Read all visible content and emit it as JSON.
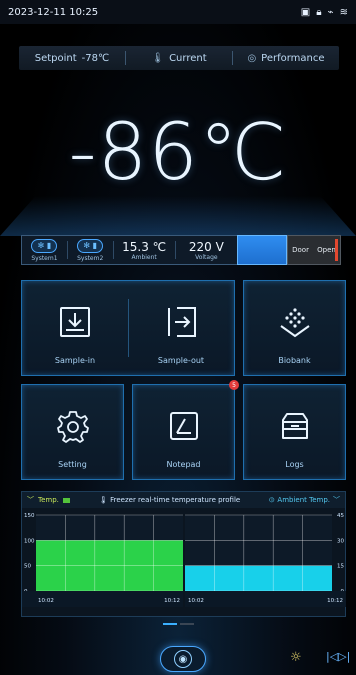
{
  "status": {
    "datetime": "2023-12-11 10:25",
    "icons": [
      "screen-icon",
      "lock-icon",
      "usb-icon",
      "wifi-icon"
    ]
  },
  "topbar": {
    "setpoint_label": "Setpoint",
    "setpoint_value": "-78℃",
    "current_label": "Current",
    "performance_label": "Performance"
  },
  "temperature": {
    "value": "-86",
    "unit": "℃"
  },
  "info": {
    "system1": "System1",
    "system2": "System2",
    "ambient_value": "15.3 ℃",
    "ambient_label": "Ambient",
    "voltage_value": "220 V",
    "voltage_label": "Voltage",
    "door_label": "Door",
    "door_state": "Open"
  },
  "tiles": {
    "sample_in": "Sample-in",
    "sample_out": "Sample-out",
    "biobank": "Biobank",
    "setting": "Setting",
    "notepad": "Notepad",
    "notepad_badge": "5",
    "logs": "Logs"
  },
  "chart_panel": {
    "left_tab": "Temp.",
    "title": "Freezer real-time temperature profile",
    "right_tab": "Ambient Temp."
  },
  "chart_data": [
    {
      "type": "bar",
      "series": [
        {
          "name": "Temp.",
          "values": [
            100
          ]
        }
      ],
      "ylim": [
        0,
        150
      ],
      "yticks": [
        "150",
        "100",
        "50",
        "0"
      ],
      "x_start": "10:02",
      "x_end": "10:12",
      "color": "#2bd24a"
    },
    {
      "type": "bar",
      "series": [
        {
          "name": "Ambient Temp.",
          "values": [
            15
          ]
        }
      ],
      "ylim": [
        0,
        45
      ],
      "yticks": [
        "45",
        "30",
        "15",
        "0"
      ],
      "x_start": "10:02",
      "x_end": "10:12",
      "color": "#18d0ea"
    }
  ],
  "colors": {
    "accent": "#3bb0ff",
    "door_indicator": "#e2482f",
    "badge": "#e23b3b"
  }
}
